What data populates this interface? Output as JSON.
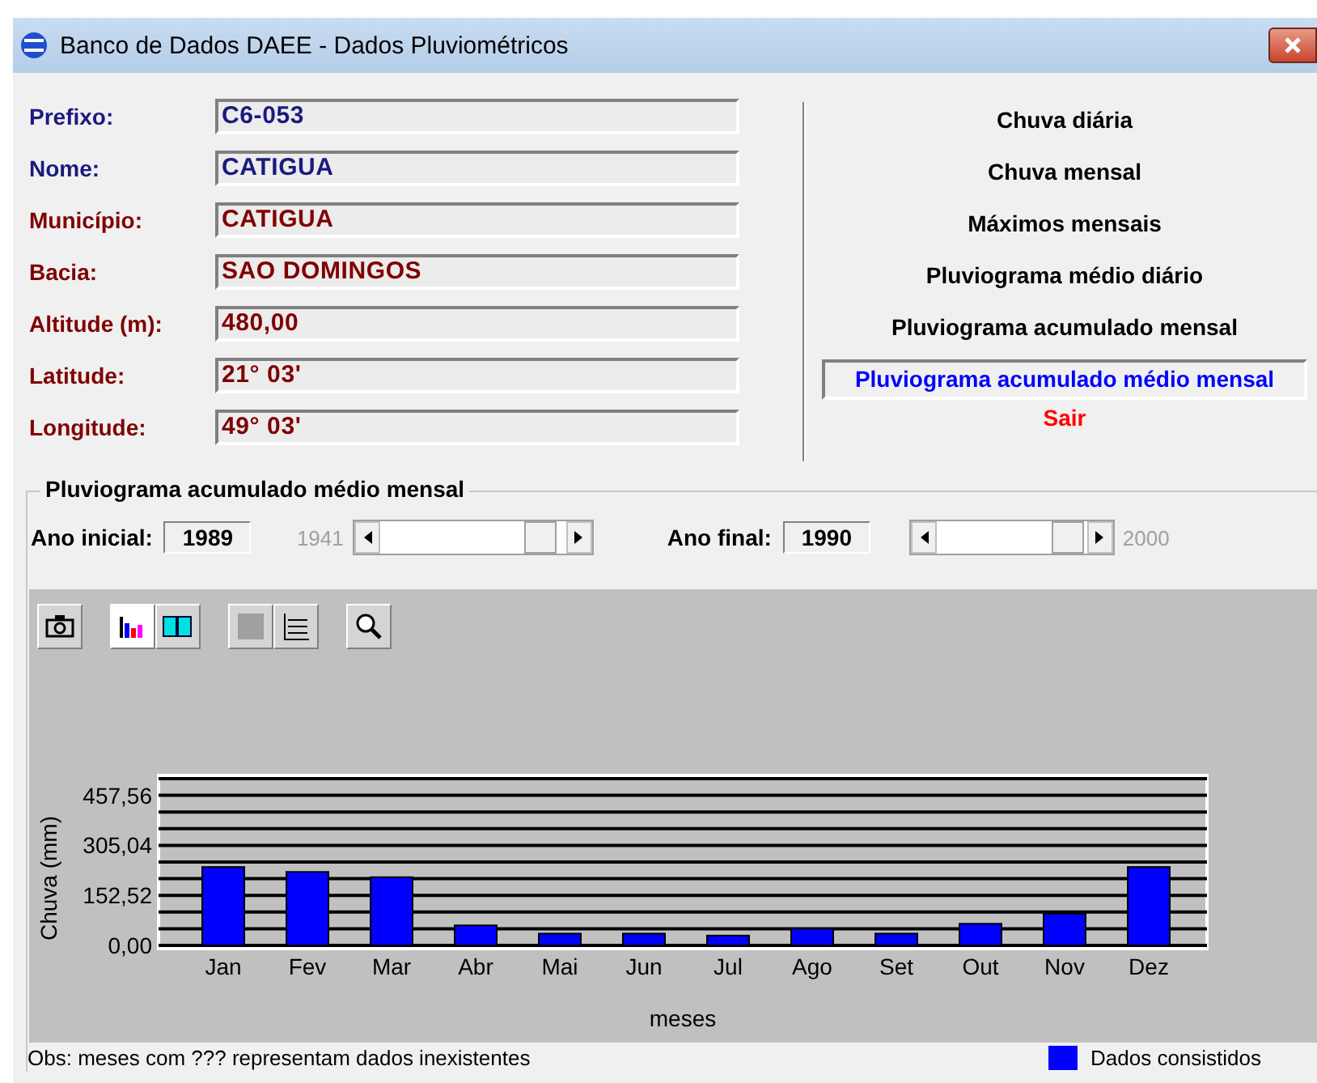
{
  "window": {
    "title": "Banco de Dados DAEE - Dados Pluviométricos"
  },
  "fields": [
    {
      "label": "Prefixo:",
      "value": "C6-053",
      "color": "#1a1a80"
    },
    {
      "label": "Nome:",
      "value": "CATIGUA",
      "color": "#1a1a80"
    },
    {
      "label": "Município:",
      "value": "CATIGUA",
      "color": "#800000"
    },
    {
      "label": "Bacia:",
      "value": "SAO DOMINGOS",
      "color": "#800000"
    },
    {
      "label": "Altitude (m):",
      "value": "480,00",
      "color": "#800000"
    },
    {
      "label": "Latitude:",
      "value": "21° 03'",
      "color": "#800000"
    },
    {
      "label": "Longitude:",
      "value": "49° 03'",
      "color": "#800000"
    }
  ],
  "menu": [
    {
      "label": "Chuva diária",
      "kind": "option",
      "selected": false
    },
    {
      "label": "Chuva mensal",
      "kind": "option",
      "selected": false
    },
    {
      "label": "Máximos mensais",
      "kind": "option",
      "selected": false
    },
    {
      "label": "Pluviograma médio diário",
      "kind": "option",
      "selected": false
    },
    {
      "label": "Pluviograma acumulado mensal",
      "kind": "option",
      "selected": false
    },
    {
      "label": "Pluviograma acumulado médio mensal",
      "kind": "option",
      "selected": true
    },
    {
      "label": "Sair",
      "kind": "exit",
      "selected": false
    }
  ],
  "group": {
    "title": "Pluviograma acumulado médio mensal",
    "ano_inicial": {
      "label": "Ano inicial:",
      "value": "1989",
      "min": "1941",
      "level": 0.86
    },
    "ano_final": {
      "label": "Ano final:",
      "value": "1990",
      "max": "2000",
      "level": 0.87
    },
    "chart_data": {
      "type": "bar",
      "xlabel": "meses",
      "ylabel": "Chuva (mm)",
      "categories": [
        "Jan",
        "Fev",
        "Mar",
        "Abr",
        "Mai",
        "Jun",
        "Jul",
        "Ago",
        "Set",
        "Out",
        "Nov",
        "Dez"
      ],
      "series": [
        {
          "name": "Dados consistidos",
          "color": "#0000ff",
          "values": [
            239,
            224,
            208,
            61,
            36,
            36,
            30,
            51,
            36,
            66,
            97,
            239
          ]
        }
      ],
      "ylim": [
        0,
        508.4
      ],
      "grid": true,
      "yticks": [
        {
          "value": 0,
          "label": "0,00"
        },
        {
          "value": 152.52,
          "label": "152,52"
        },
        {
          "value": 305.04,
          "label": "305,04"
        },
        {
          "value": 457.56,
          "label": "457,56"
        }
      ]
    }
  },
  "note": "Obs: meses com ??? representam dados inexistentes"
}
